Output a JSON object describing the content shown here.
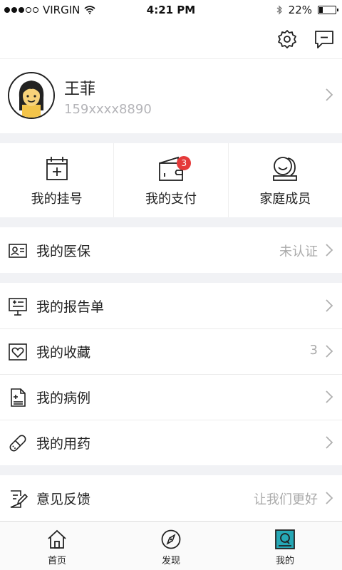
{
  "status_bar": {
    "carrier": "VIRGIN",
    "time": "4:21 PM",
    "battery": "22%",
    "battery_level": 0.22
  },
  "profile": {
    "name": "王菲",
    "phone": "159xxxx8890"
  },
  "quick_actions": [
    {
      "label": "我的挂号",
      "icon": "calendar-plus-icon"
    },
    {
      "label": "我的支付",
      "icon": "wallet-icon",
      "badge": "3"
    },
    {
      "label": "家庭成员",
      "icon": "family-icon"
    }
  ],
  "menu": {
    "insurance": {
      "label": "我的医保",
      "right": "未认证"
    },
    "report": {
      "label": "我的报告单"
    },
    "favorites": {
      "label": "我的收藏",
      "right": "3"
    },
    "cases": {
      "label": "我的病例"
    },
    "medication": {
      "label": "我的用药"
    },
    "feedback": {
      "label": "意见反馈",
      "right": "让我们更好"
    }
  },
  "tabs": [
    {
      "label": "首页",
      "icon": "home-icon"
    },
    {
      "label": "发现",
      "icon": "compass-icon"
    },
    {
      "label": "我的",
      "icon": "profile-tab-icon",
      "active": true
    }
  ],
  "colors": {
    "badge": "#e53a3a",
    "active_tab": "#26a8b6",
    "background": "#f1f2f5"
  }
}
